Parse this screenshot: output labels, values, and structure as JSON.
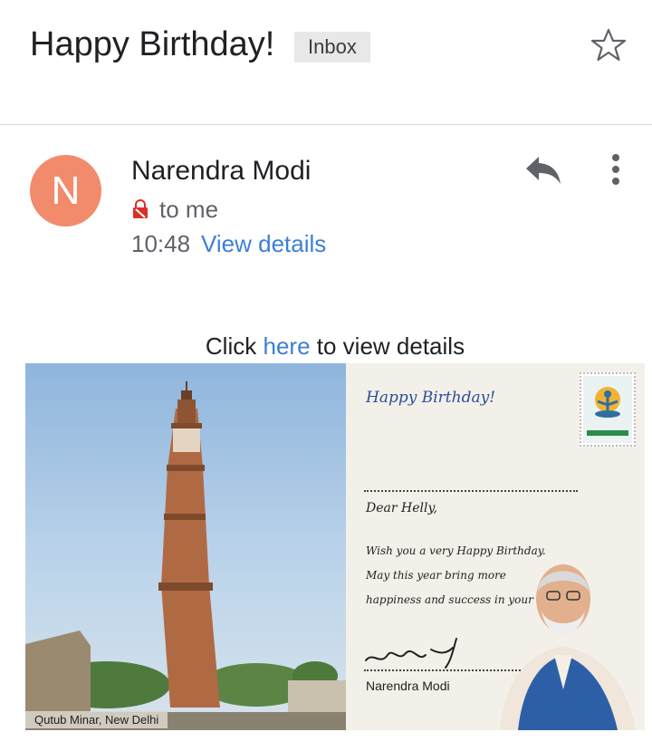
{
  "header": {
    "subject": "Happy Birthday!",
    "label": "Inbox"
  },
  "message": {
    "avatar_letter": "N",
    "avatar_color": "#f28b6b",
    "sender": "Narendra Modi",
    "recipient": "to me",
    "time": "10:48",
    "view_details": "View details"
  },
  "body": {
    "click_prefix": "Click",
    "click_link": "here",
    "click_suffix": "to view details"
  },
  "card": {
    "photo_caption": "Qutub Minar, New Delhi",
    "greeting": "Happy Birthday!",
    "dear": "Dear Helly,",
    "lines": [
      "Wish you a very Happy Birthday.",
      "May this year bring more",
      "happiness and success in your life!"
    ],
    "signature_name": "Narendra Modi"
  },
  "colors": {
    "link": "#3d7fd6",
    "chip_bg": "#e8e8e8",
    "lock": "#d93025"
  }
}
